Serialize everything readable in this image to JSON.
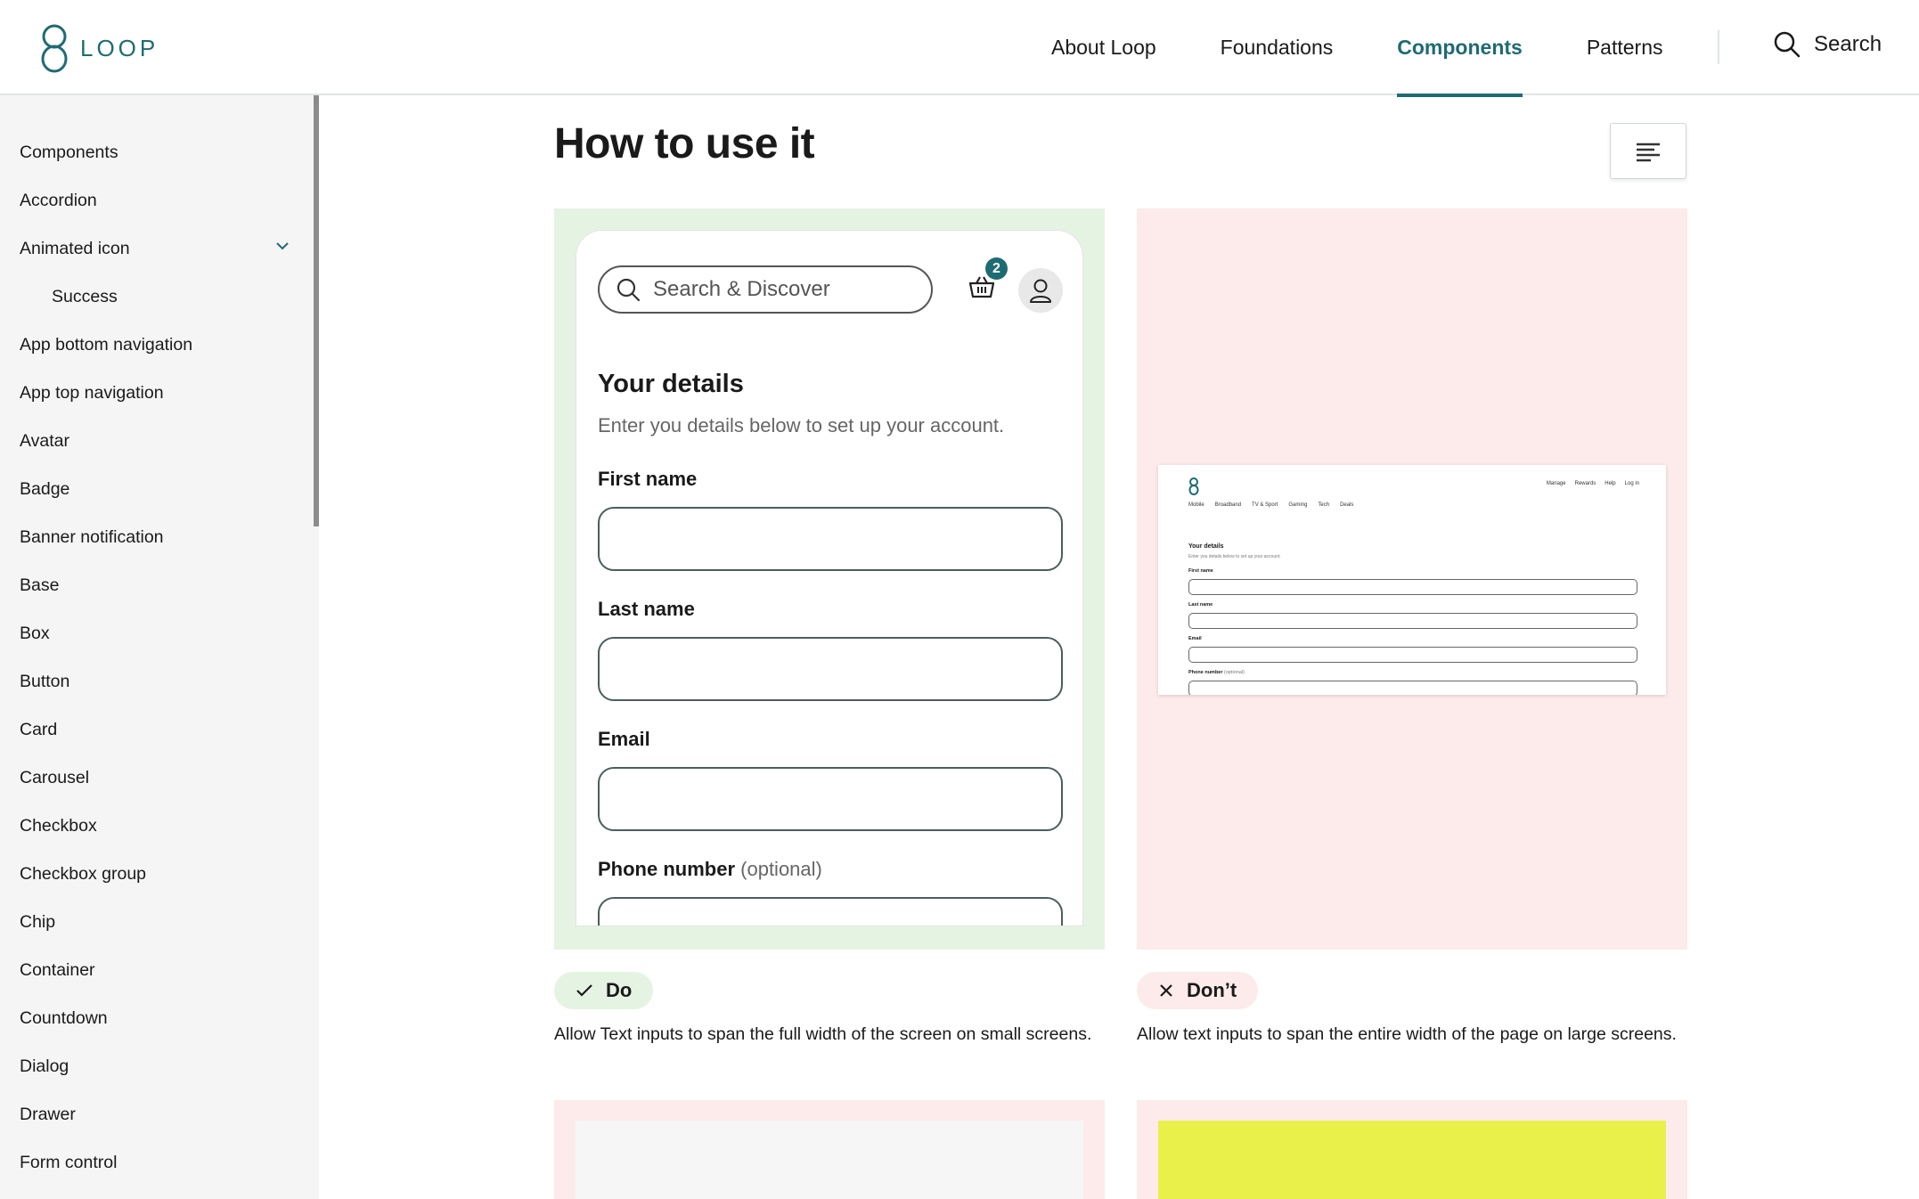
{
  "header": {
    "logo_text": "LOOP",
    "nav": [
      {
        "label": "About Loop"
      },
      {
        "label": "Foundations"
      },
      {
        "label": "Components",
        "active": true
      },
      {
        "label": "Patterns"
      }
    ],
    "search_label": "Search"
  },
  "sidebar": {
    "items": [
      {
        "label": "Components"
      },
      {
        "label": "Accordion"
      },
      {
        "label": "Animated icon",
        "expanded": true
      },
      {
        "label": "Success",
        "sub": true
      },
      {
        "label": "App bottom navigation"
      },
      {
        "label": "App top navigation"
      },
      {
        "label": "Avatar"
      },
      {
        "label": "Badge"
      },
      {
        "label": "Banner notification"
      },
      {
        "label": "Base"
      },
      {
        "label": "Box"
      },
      {
        "label": "Button"
      },
      {
        "label": "Card"
      },
      {
        "label": "Carousel"
      },
      {
        "label": "Checkbox"
      },
      {
        "label": "Checkbox group"
      },
      {
        "label": "Chip"
      },
      {
        "label": "Container"
      },
      {
        "label": "Countdown"
      },
      {
        "label": "Dialog"
      },
      {
        "label": "Drawer"
      },
      {
        "label": "Form control"
      }
    ]
  },
  "main": {
    "title": "How to use it",
    "do_example": {
      "search_placeholder": "Search & Discover",
      "basket_count": "2",
      "heading": "Your details",
      "subheading": "Enter you details below to set up your account.",
      "first_name_label": "First name",
      "last_name_label": "Last name",
      "email_label": "Email",
      "phone_label": "Phone number",
      "phone_optional": "(optional)"
    },
    "dont_example": {
      "nav": [
        "Mobile",
        "Broadband",
        "TV & Sport",
        "Gaming",
        "Tech",
        "Deals"
      ],
      "top_links": [
        "Manage",
        "Rewards",
        "Help",
        "Log in"
      ],
      "heading": "Your details",
      "subheading": "Enter you details below to set up your account.",
      "first_name_label": "First name",
      "last_name_label": "Last name",
      "email_label": "Email",
      "phone_label": "Phone number",
      "phone_optional": "(optional)"
    },
    "do_tag": "Do",
    "dont_tag": "Don’t",
    "do_caption": "Allow Text inputs to span the full width of the screen on small screens.",
    "dont_caption": "Allow text inputs to span the entire width of the page on large screens."
  },
  "colors": {
    "brand": "#1f6b74",
    "do_bg": "#e5f3e3",
    "dont_bg": "#fcebea",
    "sidebar_bg": "#f5f5f5"
  }
}
